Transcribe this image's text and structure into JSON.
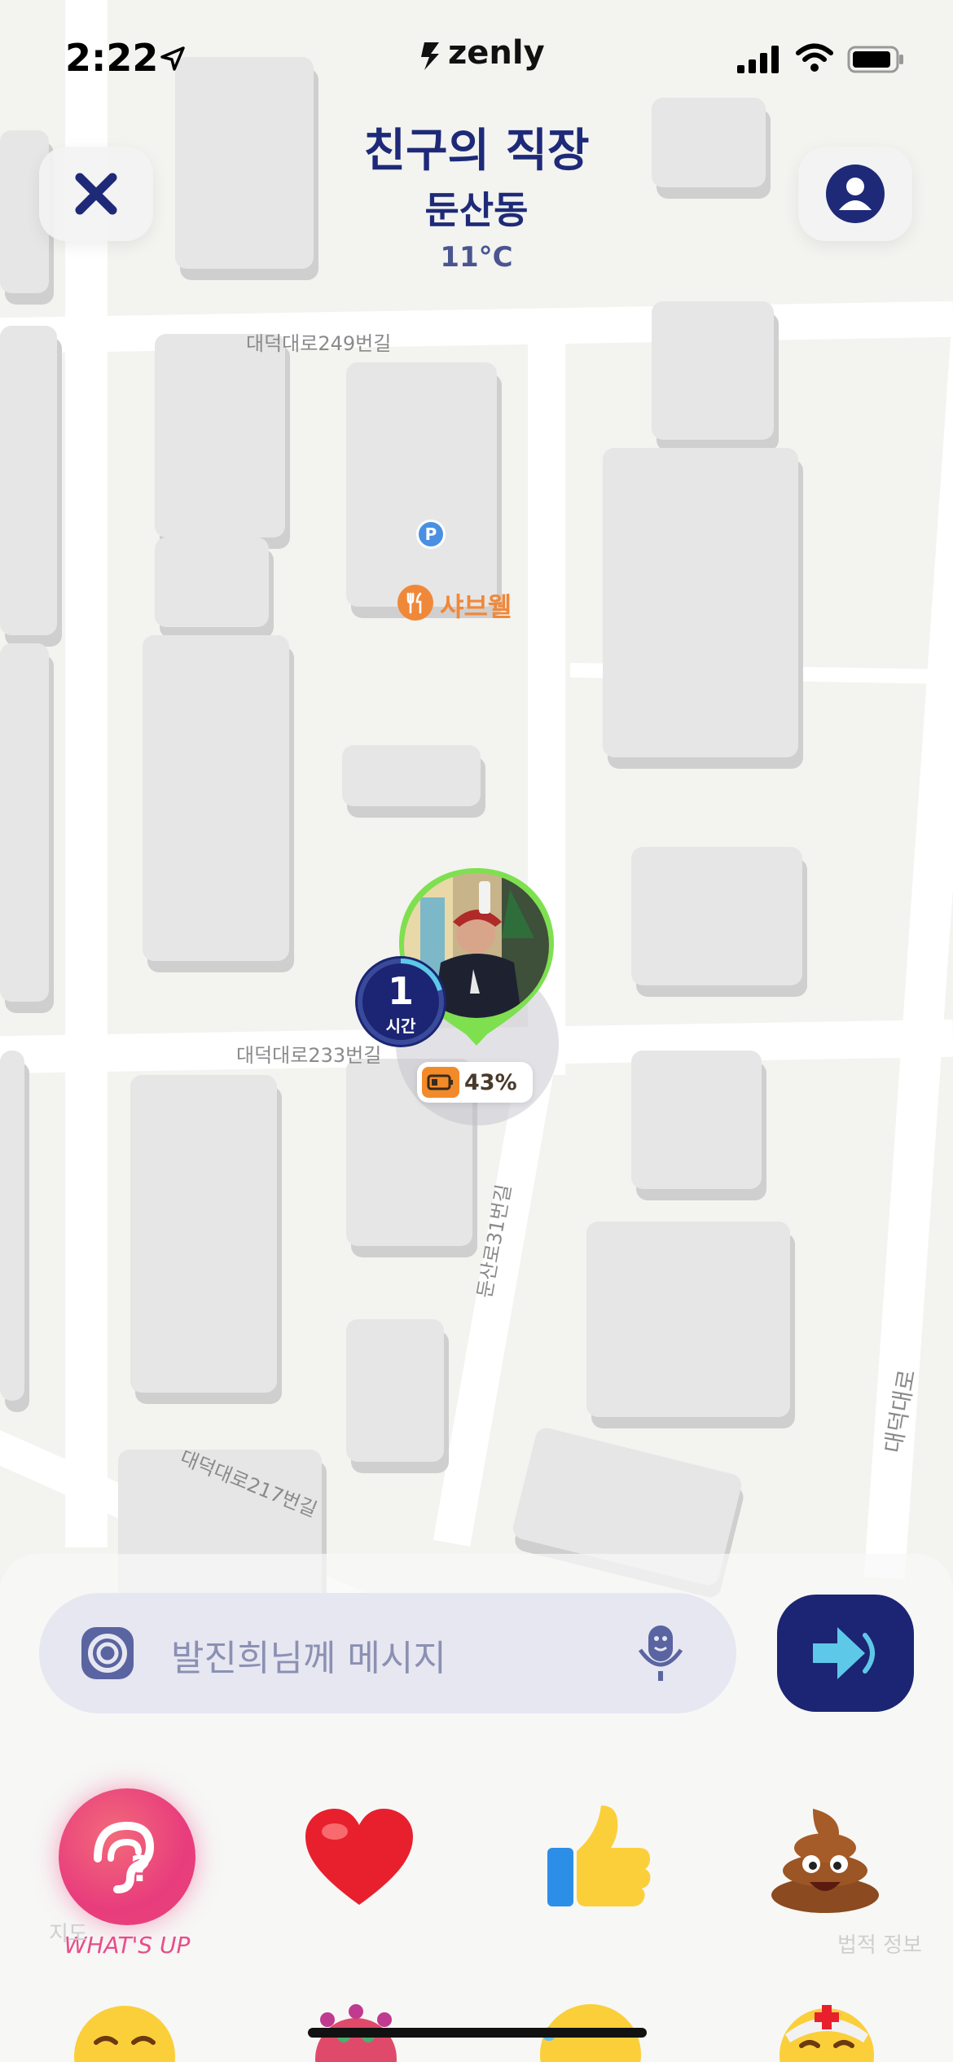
{
  "status_bar": {
    "time": "2:22",
    "brand": "zenly"
  },
  "header": {
    "title": "친구의 직장",
    "subtitle": "둔산동",
    "temperature": "11°C"
  },
  "map": {
    "road_labels": [
      "대덕대로249번길",
      "대덕대로233번길",
      "대덕대로217번길",
      "둔산로31번길",
      "대덕대로"
    ],
    "poi_name": "샤브웰",
    "parking_label": "P"
  },
  "friend_pin": {
    "duration_value": "1",
    "duration_unit": "시간",
    "battery_percent": "43%",
    "battery_fraction": 0.43
  },
  "message_bar": {
    "placeholder": "발진희님께 메시지"
  },
  "reactions": {
    "whats_up_label": "WHAT'S UP",
    "items": [
      "heart-emoji",
      "thumbs-up-emoji",
      "poop-emoji"
    ]
  },
  "faint_labels": {
    "left": "지도",
    "right": "법적 정보"
  },
  "colors": {
    "navy": "#1b2573",
    "title_blue": "#1e2a78",
    "pin_green": "#7ee04f",
    "whatsup_pink": "#e83d7d",
    "poi_orange": "#f0883a"
  }
}
